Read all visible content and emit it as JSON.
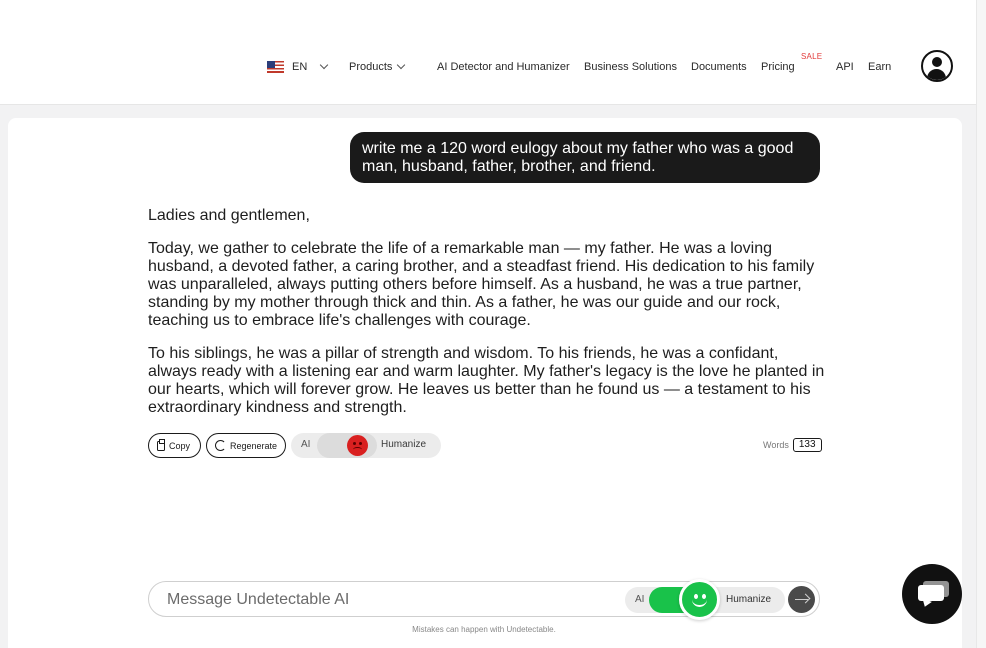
{
  "header": {
    "language": "EN",
    "nav": {
      "products": "Products",
      "ai_detector": "AI Detector and Humanizer",
      "business": "Business Solutions",
      "documents": "Documents",
      "pricing": "Pricing",
      "sale_badge": "SALE",
      "api": "API",
      "earn": "Earn"
    }
  },
  "conversation": {
    "user_message": "write me a 120 word eulogy about my father who was a good man, husband, father, brother, and friend.",
    "reply_paragraphs": [
      "Ladies and gentlemen,",
      "Today, we gather to celebrate the life of a remarkable man — my father. He was a loving husband, a devoted father, a caring brother, and a steadfast friend. His dedication to his family was unparalleled, always putting others before himself. As a husband, he was a true partner, standing by my mother through thick and thin. As a father, he was our guide and our rock, teaching us to embrace life's challenges with courage.",
      "To his siblings, he was a pillar of strength and wisdom. To his friends, he was a confidant, always ready with a listening ear and warm laughter. My father's legacy is the love he planted in our hearts, which will forever grow. He leaves us better than he found us — a testament to his extraordinary kindness and strength."
    ]
  },
  "actions": {
    "copy": "Copy",
    "regenerate": "Regenerate",
    "toggle_ai": "AI",
    "toggle_humanize": "Humanize",
    "words_label": "Words",
    "word_count": "133"
  },
  "composer": {
    "placeholder": "Message Undetectable AI",
    "toggle_ai": "AI",
    "toggle_humanize": "Humanize",
    "disclaimer": "Mistakes can happen with Undetectable."
  },
  "colors": {
    "accent_green": "#19c24a",
    "ai_red": "#d92020",
    "bubble_dark": "#1a1a1a"
  }
}
